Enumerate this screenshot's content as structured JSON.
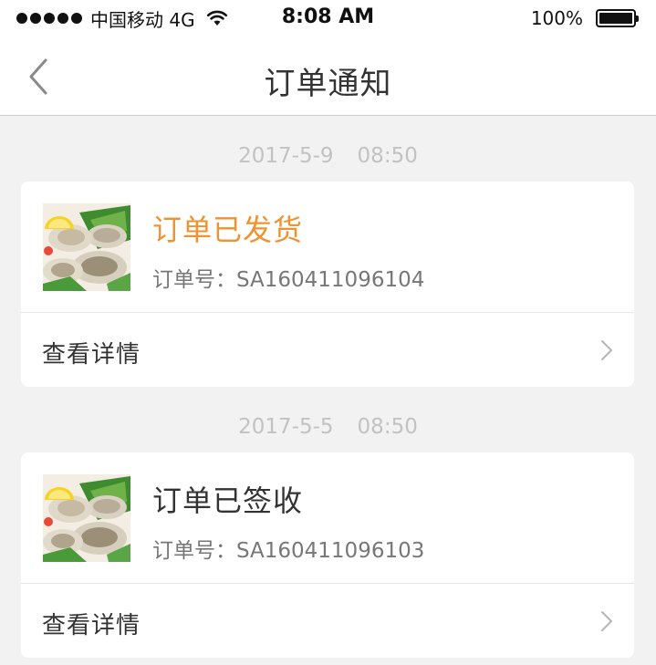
{
  "status_bar": {
    "carrier": "中国移动 4G",
    "time": "8:08 AM",
    "battery": "100%"
  },
  "nav": {
    "title": "订单通知",
    "back_icon": "chevron-left-icon"
  },
  "notifications": [
    {
      "date": "2017-5-9",
      "time": "08:50",
      "title": "订单已发货",
      "title_color": "#f0922d",
      "order_no": "订单号：SA160411096104",
      "detail_label": "查看详情"
    },
    {
      "date": "2017-5-5",
      "time": "08:50",
      "title": "订单已签收",
      "title_color": "#333333",
      "order_no": "订单号：SA160411096103",
      "detail_label": "查看详情"
    }
  ]
}
